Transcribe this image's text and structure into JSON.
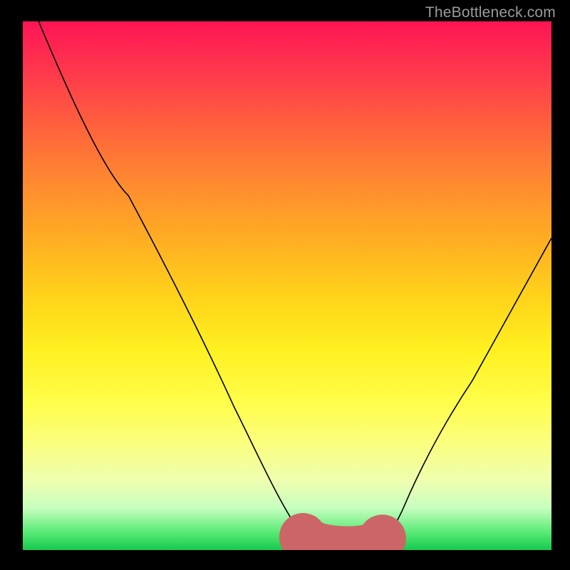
{
  "attribution": "TheBottleneck.com",
  "chart_data": {
    "type": "line",
    "title": "",
    "xlabel": "",
    "ylabel": "",
    "xlim": [
      0,
      100
    ],
    "ylim": [
      0,
      100
    ],
    "series": [
      {
        "name": "bottleneck-curve",
        "x": [
          3,
          10,
          20,
          30,
          40,
          47,
          52,
          55,
          58,
          60,
          63,
          66,
          68,
          72,
          78,
          85,
          92,
          100
        ],
        "y": [
          100,
          86,
          67,
          47,
          27,
          12,
          4,
          1,
          0,
          0,
          0,
          0.5,
          2,
          8,
          18,
          30,
          44,
          59
        ]
      }
    ],
    "highlight": {
      "name": "optimal-zone",
      "color": "#cc6666",
      "x": [
        53,
        55,
        57,
        59,
        61,
        63,
        65,
        67
      ],
      "y": [
        2,
        1,
        0.3,
        0,
        0,
        0,
        0.3,
        1.5
      ]
    }
  }
}
